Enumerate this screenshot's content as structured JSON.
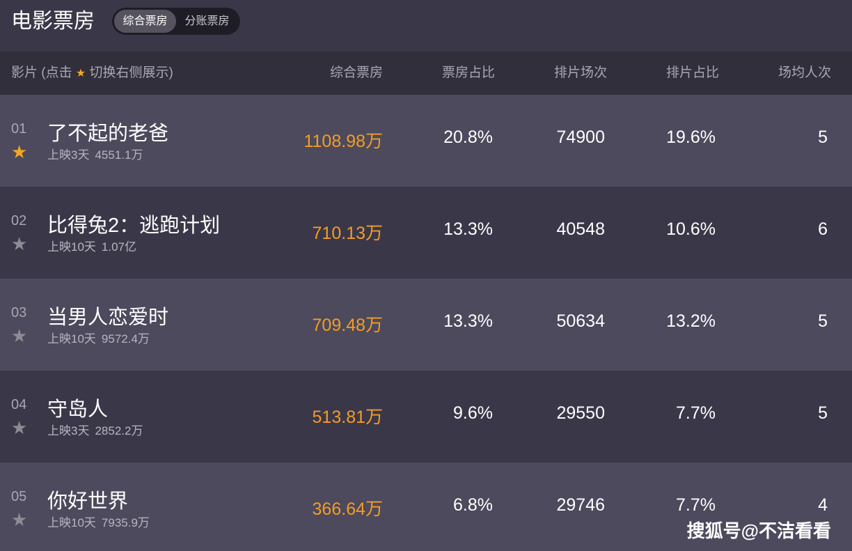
{
  "page": {
    "title": "电影票房"
  },
  "tabs": [
    {
      "label": "综合票房",
      "active": true
    },
    {
      "label": "分账票房",
      "active": false
    }
  ],
  "columns": {
    "film_prefix": "影片 (点击",
    "film_star_icon": "star-icon",
    "film_suffix": "切换右侧展示)",
    "gross": "综合票房",
    "share": "票房占比",
    "shows": "排片场次",
    "show_share": "排片占比",
    "avg": "场均人次"
  },
  "films": [
    {
      "rank": "01",
      "name": "了不起的老爸",
      "days": "上映3天",
      "total": "4551.1万",
      "gross": "1108.98万",
      "share": "20.8%",
      "shows": "74900",
      "show_share": "19.6%",
      "avg": "5",
      "starred": true
    },
    {
      "rank": "02",
      "name": "比得兔2：逃跑计划",
      "days": "上映10天",
      "total": "1.07亿",
      "gross": "710.13万",
      "share": "13.3%",
      "shows": "40548",
      "show_share": "10.6%",
      "avg": "6",
      "starred": false
    },
    {
      "rank": "03",
      "name": "当男人恋爱时",
      "days": "上映10天",
      "total": "9572.4万",
      "gross": "709.48万",
      "share": "13.3%",
      "shows": "50634",
      "show_share": "13.2%",
      "avg": "5",
      "starred": false
    },
    {
      "rank": "04",
      "name": "守岛人",
      "days": "上映3天",
      "total": "2852.2万",
      "gross": "513.81万",
      "share": "9.6%",
      "shows": "29550",
      "show_share": "7.7%",
      "avg": "5",
      "starred": false
    },
    {
      "rank": "05",
      "name": "你好世界",
      "days": "上映10天",
      "total": "7935.9万",
      "gross": "366.64万",
      "share": "6.8%",
      "shows": "29746",
      "show_share": "7.7%",
      "avg": "4",
      "starred": false
    }
  ],
  "watermark": "搜狐号@不洁看看",
  "colors": {
    "accent": "#f79b24",
    "star_active": "#f5a623",
    "star_inactive": "#8d8b96"
  }
}
